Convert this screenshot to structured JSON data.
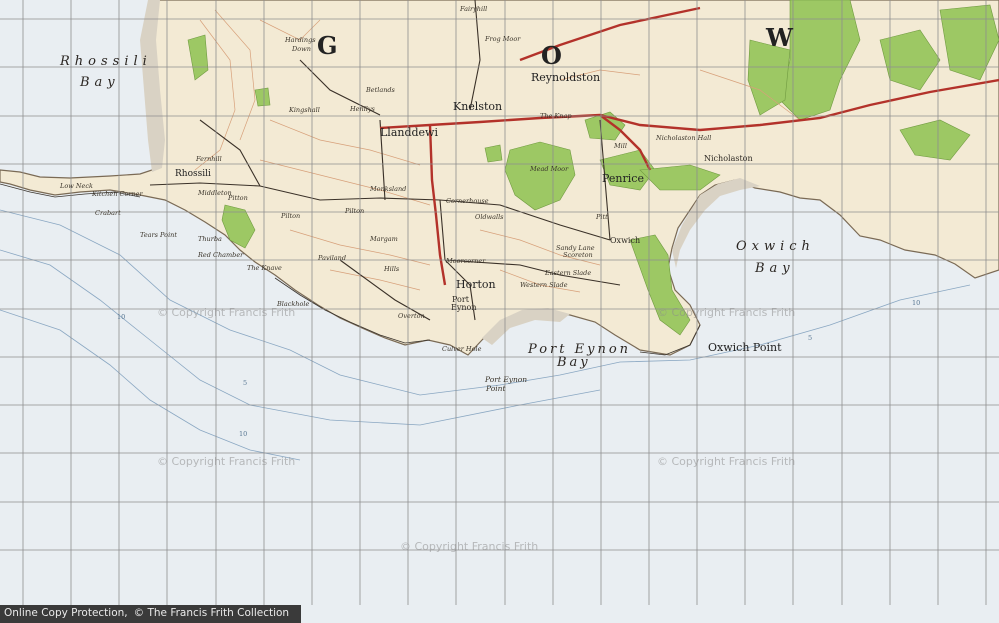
{
  "map": {
    "regions": {
      "letter_g": "G",
      "letter_o": "O",
      "letter_w": "W"
    },
    "bays": {
      "rhossili_1": "Rhossili",
      "rhossili_2": "Bay",
      "oxwich_1": "Oxwich",
      "oxwich_2": "Bay",
      "port_eynon_1": "Port Eynon",
      "port_eynon_2": "Bay"
    },
    "points": {
      "oxwich_point": "Oxwich Point",
      "port_eynon_point_1": "Port Eynon",
      "port_eynon_point_2": "Point"
    },
    "towns": {
      "reynoldston": "Reynoldston",
      "knelston": "Knelston",
      "llanddewi": "Llanddewi",
      "penrice": "Penrice",
      "horton": "Horton",
      "port_eynon_1": "Port",
      "port_eynon_2": "Eynon",
      "oxwich": "Oxwich",
      "rhossili": "Rhossili",
      "nicholaston": "Nicholaston"
    },
    "villages": {
      "hardings_down": "Hardings",
      "down": "Down",
      "fernhill": "Fernhill",
      "middleton": "Middleton",
      "pilton": "Pilton",
      "pitton": "Pitton",
      "monksland": "Monksland",
      "cornerhouse": "Cornerhouse",
      "margam": "Margam",
      "pilton_green": "Pilton",
      "moorcorner": "Moorcorner",
      "pitt": "Pitt",
      "eastern_slade": "Eastern Slade",
      "western_slade": "Western Slade",
      "overton": "Overton",
      "paviland": "Paviland",
      "hills": "Hills",
      "kingshall": "Kingshall",
      "henllys": "Henllys",
      "betlands": "Betlands",
      "sandy_lane": "Sandy Lane",
      "mead_moor": "Mead Moor",
      "low_neck": "Low Neck",
      "kitchen_corner": "Kitchen Corner",
      "crabart": "Crabart",
      "tears_point": "Tears Point",
      "thurba": "Thurba",
      "red_chamber": "Red Chamber",
      "the_knave": "The Knave",
      "blackhole": "Blackhole",
      "culver_hole": "Culver Hole",
      "oldwalls": "Oldwalls",
      "fairyhill": "Fairyhill",
      "frog_moor": "Frog Moor",
      "the_knap": "The Knap",
      "nicholaston_hall": "Nicholaston Hall",
      "mill": "Mill",
      "scoreton": "Scoreton"
    },
    "depth_labels": [
      "10",
      "5",
      "10",
      "5",
      "10"
    ],
    "grid": {
      "columns": 21,
      "rows": 12,
      "line_color": "#8e8e8e"
    },
    "colors": {
      "sea": "#e9eef2",
      "land": "#f3ead4",
      "wood": "#9dc864",
      "sand": "#d9d2c4",
      "contour": "#d7a07a",
      "road": "#b3322a"
    }
  },
  "watermarks": [
    "© Copyright Francis Frith",
    "© Copyright Francis Frith",
    "© Copyright Francis Frith",
    "© Copyright Francis Frith",
    "© Copyright Francis Frith"
  ],
  "footer": {
    "label_1": "Online Copy Protection,",
    "label_2": "© The Francis Frith Collection"
  }
}
